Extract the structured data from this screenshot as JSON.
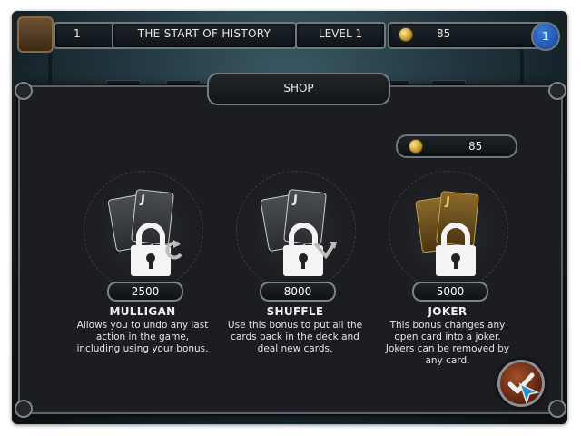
{
  "hud": {
    "level_number": "1",
    "title": "THE START OF HISTORY",
    "level_label": "LEVEL 1",
    "coins": "85",
    "blue_badge": "1"
  },
  "shop": {
    "tab_title": "SHOP",
    "balance": "85",
    "items": [
      {
        "name": "MULLIGAN",
        "price": "2500",
        "description": "Allows you to undo any last action in the game, including using your bonus.",
        "locked": true,
        "card_rank": "J",
        "icon": "undo-icon"
      },
      {
        "name": "SHUFFLE",
        "price": "8000",
        "description": "Use this bonus to put all the cards back in the deck and deal new cards.",
        "locked": true,
        "card_rank": "J",
        "icon": "shuffle-icon"
      },
      {
        "name": "JOKER",
        "price": "5000",
        "description": "This bonus changes any open card into a joker. Jokers can be removed by any card.",
        "locked": true,
        "card_rank": "J",
        "icon": "joker-card-icon"
      }
    ]
  },
  "colors": {
    "dialog_bg": "#1b1d20",
    "frame": "#767d84",
    "gold_card": "#8a6a2a",
    "confirm_button": "#a3502a"
  }
}
